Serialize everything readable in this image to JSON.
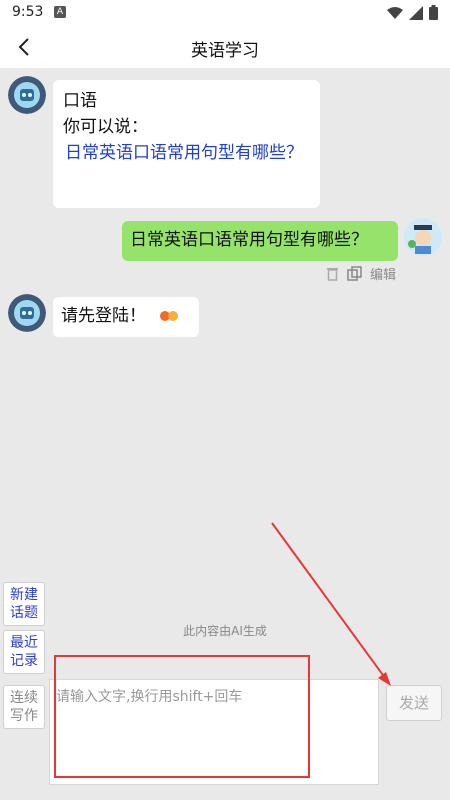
{
  "status": {
    "time": "9:53",
    "notif_letter": "A"
  },
  "nav": {
    "title": "英语学习"
  },
  "messages": {
    "bot1": {
      "line1": "口语",
      "line2": "你可以说：",
      "suggestion": "日常英语口语常用句型有哪些？"
    },
    "user1": {
      "text": "日常英语口语常用句型有哪些？",
      "edit_label": "编辑"
    },
    "bot2": {
      "text": "请先登陆！"
    }
  },
  "ai_note": "此内容由AI生成",
  "side_buttons": {
    "new_topic": "新建话题",
    "recent": "最近记录",
    "continue": "连续写作"
  },
  "input": {
    "placeholder": "请输入文字,换行用shift+回车"
  },
  "send": {
    "label": "发送"
  },
  "colors": {
    "user_bubble": "#95e36a",
    "link": "#1f3fd6",
    "annotation": "#e53935"
  }
}
